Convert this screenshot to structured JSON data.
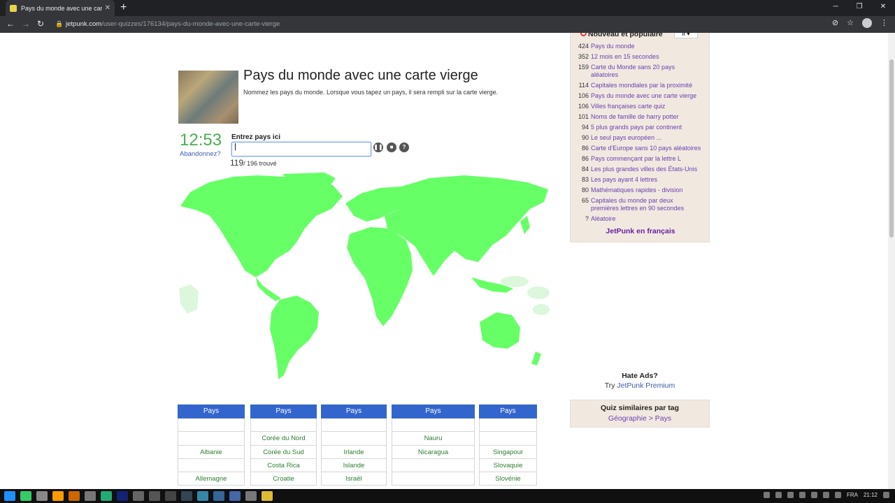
{
  "browser": {
    "tab_title": "Pays du monde avec une carte vi",
    "tab_close": "✕",
    "new_tab": "+",
    "url_host": "jetpunk.com",
    "url_path": "/user-quizzes/176134/pays-du-monde-avec-une-carte-vierge"
  },
  "quiz": {
    "title": "Pays du monde avec une carte vierge",
    "description": "Nommez les pays du monde. Lorsque vous tapez un pays, il sera rempli sur la carte vierge.",
    "timer": "12:53",
    "give_up": "Abandonnez?",
    "enter_label": "Entrez pays ici",
    "input_value": "|",
    "found_count": "119",
    "found_total": "/ 196 trouvé"
  },
  "sidebar": {
    "heading": "Nouveau et populaire",
    "select_value": "fr ▾",
    "items": [
      {
        "count": "424",
        "label": "Pays du monde"
      },
      {
        "count": "352",
        "label": "12 mois en 15 secondes"
      },
      {
        "count": "159",
        "label": "Carte du Monde sans 20 pays aléatoires"
      },
      {
        "count": "114",
        "label": "Capitales mondiales par la proximité"
      },
      {
        "count": "106",
        "label": "Pays du monde avec une carte vierge"
      },
      {
        "count": "106",
        "label": "Villes françaises carte quiz"
      },
      {
        "count": "101",
        "label": "Noms de famille de harry potter"
      },
      {
        "count": "94",
        "label": "5 plus grands pays par continent"
      },
      {
        "count": "90",
        "label": "Le seul pays européen ..."
      },
      {
        "count": "86",
        "label": "Carte d'Europe sans 10 pays aléatoires"
      },
      {
        "count": "86",
        "label": "Pays commençant par la lettre L"
      },
      {
        "count": "84",
        "label": "Les plus grandes villes des États-Unis"
      },
      {
        "count": "83",
        "label": "Les pays ayant 4 lettres"
      },
      {
        "count": "80",
        "label": "Mathématiques rapides - division"
      },
      {
        "count": "65",
        "label": "Capitales du monde par deux premières lettres en 90 secondes"
      },
      {
        "count": "?",
        "label": "Aléatoire"
      }
    ],
    "footer": "JetPunk en français"
  },
  "ads": {
    "hate_ads": "Hate Ads?",
    "try_prefix": "Try ",
    "try_link": "JetPunk Premium"
  },
  "similar": {
    "title": "Quiz similaires par tag",
    "path": "Géographie > Pays"
  },
  "answer_table": {
    "columns": [
      {
        "header": "Pays",
        "cells": [
          "",
          "",
          "Albanie",
          "",
          "Allemagne"
        ]
      },
      {
        "header": "Pays",
        "cells": [
          "",
          "Corée du Nord",
          "Corée du Sud",
          "Costa Rica",
          "Croatie"
        ]
      },
      {
        "header": "Pays",
        "cells": [
          "",
          "",
          "Irlande",
          "Islande",
          "Israël"
        ]
      },
      {
        "header": "Pays",
        "cells": [
          "",
          "Nauru",
          "Nicaragua",
          "",
          ""
        ]
      },
      {
        "header": "Pays",
        "cells": [
          "",
          "",
          "Singapour",
          "Slovaquie",
          "Slovénie"
        ]
      }
    ]
  },
  "taskbar": {
    "lang": "FRA",
    "time": "21:12"
  },
  "colors": {
    "land_found": "#66ff66",
    "land_missing": "#dcf7dc",
    "header_blue": "#3366cc",
    "timer_green": "#4caf50"
  }
}
